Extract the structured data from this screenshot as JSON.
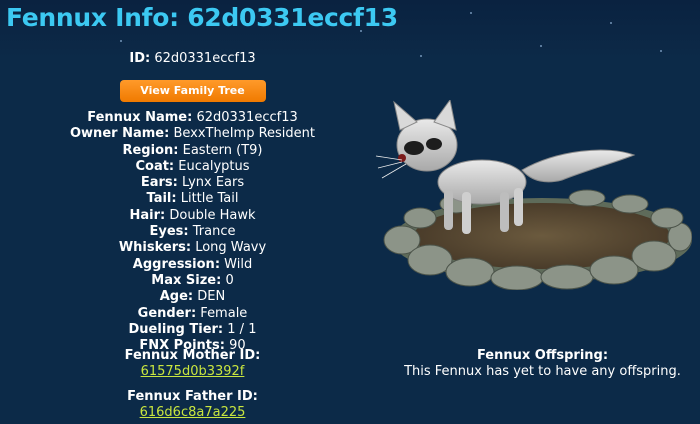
{
  "header": {
    "title": "Fennux Info: 62d0331eccf13"
  },
  "summary": {
    "id_label": "ID:",
    "id_value": "62d0331eccf13",
    "button_label": "View Family Tree"
  },
  "details": [
    {
      "label": "Fennux Name:",
      "value": "62d0331eccf13"
    },
    {
      "label": "Owner Name:",
      "value": "BexxTheImp Resident"
    },
    {
      "label": "Region:",
      "value": "Eastern (T9)"
    },
    {
      "label": "Coat:",
      "value": "Eucalyptus"
    },
    {
      "label": "Ears:",
      "value": "Lynx Ears"
    },
    {
      "label": "Tail:",
      "value": "Little Tail"
    },
    {
      "label": "Hair:",
      "value": "Double Hawk"
    },
    {
      "label": "Eyes:",
      "value": "Trance"
    },
    {
      "label": "Whiskers:",
      "value": "Long Wavy"
    },
    {
      "label": "Aggression:",
      "value": "Wild"
    },
    {
      "label": "Max Size:",
      "value": "0"
    },
    {
      "label": "Age:",
      "value": "DEN"
    },
    {
      "label": "Gender:",
      "value": "Female"
    },
    {
      "label": "Dueling Tier:",
      "value": "1 / 1"
    },
    {
      "label": "FNX Points:",
      "value": "90"
    }
  ],
  "parents": {
    "mother_label": "Fennux Mother ID:",
    "mother_id": "61575d0b3392f",
    "father_label": "Fennux Father ID:",
    "father_id": "616d6c8a7a225"
  },
  "offspring": {
    "label": "Fennux Offspring:",
    "text": "This Fennux has yet to have any offspring."
  },
  "colors": {
    "title": "#3cc9f2",
    "background": "#0c2a48",
    "button": "#f5840c",
    "link": "#c9e63f"
  }
}
